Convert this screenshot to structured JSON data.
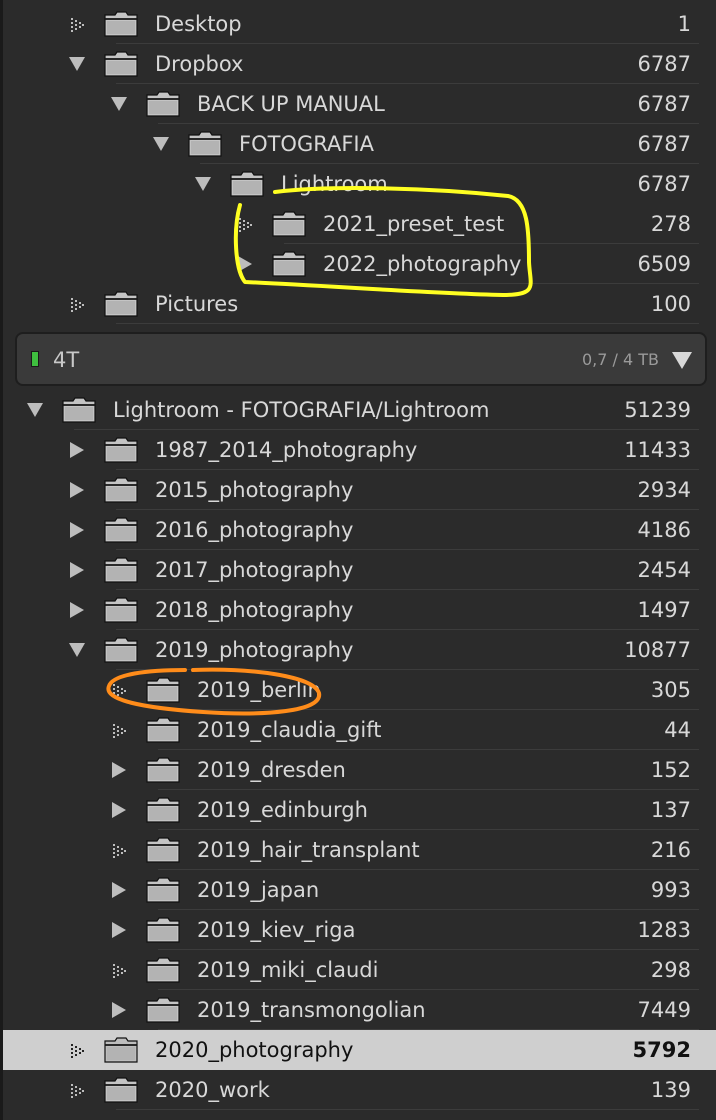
{
  "colors": {
    "panel_bg": "#2b2b2b",
    "selected_row_bg": "#cfcfcf",
    "folder_fill": "#c2c2c2",
    "highlight_yellow": "#ffff22",
    "highlight_orange": "#ff8c1a",
    "volume_led": "#3fbf3f"
  },
  "volume": {
    "name": "4T",
    "space": "0,7 / 4 TB",
    "menu_icon": "triangle-down-icon"
  },
  "rows": [
    {
      "name": "Desktop",
      "count": "1",
      "toggle": "none"
    },
    {
      "name": "Dropbox",
      "count": "6787",
      "toggle": "expanded"
    },
    {
      "name": "BACK UP MANUAL",
      "count": "6787",
      "toggle": "expanded"
    },
    {
      "name": "FOTOGRAFIA",
      "count": "6787",
      "toggle": "expanded"
    },
    {
      "name": "Lightroom",
      "count": "6787",
      "toggle": "expanded"
    },
    {
      "name": "2021_preset_test",
      "count": "278",
      "toggle": "none"
    },
    {
      "name": "2022_photography",
      "count": "6509",
      "toggle": "collapsed"
    },
    {
      "name": "Pictures",
      "count": "100",
      "toggle": "none"
    },
    {
      "name": "Lightroom - FOTOGRAFIA/Lightroom",
      "count": "51239",
      "toggle": "expanded"
    },
    {
      "name": "1987_2014_photography",
      "count": "11433",
      "toggle": "collapsed"
    },
    {
      "name": "2015_photography",
      "count": "2934",
      "toggle": "collapsed"
    },
    {
      "name": "2016_photography",
      "count": "4186",
      "toggle": "collapsed"
    },
    {
      "name": "2017_photography",
      "count": "2454",
      "toggle": "collapsed"
    },
    {
      "name": "2018_photography",
      "count": "1497",
      "toggle": "collapsed"
    },
    {
      "name": "2019_photography",
      "count": "10877",
      "toggle": "expanded"
    },
    {
      "name": "2019_berlin",
      "count": "305",
      "toggle": "none"
    },
    {
      "name": "2019_claudia_gift",
      "count": "44",
      "toggle": "none"
    },
    {
      "name": "2019_dresden",
      "count": "152",
      "toggle": "collapsed"
    },
    {
      "name": "2019_edinburgh",
      "count": "137",
      "toggle": "collapsed"
    },
    {
      "name": "2019_hair_transplant",
      "count": "216",
      "toggle": "none"
    },
    {
      "name": "2019_japan",
      "count": "993",
      "toggle": "collapsed"
    },
    {
      "name": "2019_kiev_riga",
      "count": "1283",
      "toggle": "collapsed"
    },
    {
      "name": "2019_miki_claudi",
      "count": "298",
      "toggle": "none"
    },
    {
      "name": "2019_transmongolian",
      "count": "7449",
      "toggle": "collapsed"
    },
    {
      "name": "2020_photography",
      "count": "5792",
      "toggle": "none",
      "selected": true
    },
    {
      "name": "2020_work",
      "count": "139",
      "toggle": "none"
    }
  ]
}
